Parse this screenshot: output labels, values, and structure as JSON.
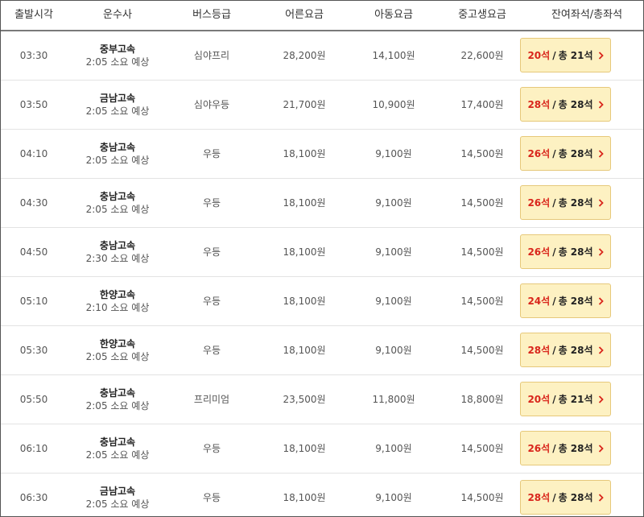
{
  "columns": {
    "departure_time": "출발시각",
    "company": "운수사",
    "bus_grade": "버스등급",
    "adult_fare": "어른요금",
    "child_fare": "아동요금",
    "teen_fare": "중고생요금",
    "seats": "잔여좌석/총좌석"
  },
  "accent_colors": {
    "remaining_seats": "#d9261c",
    "button_bg": "#fdf1c2",
    "button_border": "#e6c87a"
  },
  "rows": [
    {
      "time": "03:30",
      "company": "중부고속",
      "duration": "2:05 소요 예상",
      "grade": "심야프리",
      "adult": "28,200원",
      "child": "14,100원",
      "teen": "22,600원",
      "remaining": "20석",
      "sep": "/",
      "total": "총 21석"
    },
    {
      "time": "03:50",
      "company": "금남고속",
      "duration": "2:05 소요 예상",
      "grade": "심야우등",
      "adult": "21,700원",
      "child": "10,900원",
      "teen": "17,400원",
      "remaining": "28석",
      "sep": "/",
      "total": "총 28석"
    },
    {
      "time": "04:10",
      "company": "충남고속",
      "duration": "2:05 소요 예상",
      "grade": "우등",
      "adult": "18,100원",
      "child": "9,100원",
      "teen": "14,500원",
      "remaining": "26석",
      "sep": "/",
      "total": "총 28석"
    },
    {
      "time": "04:30",
      "company": "충남고속",
      "duration": "2:05 소요 예상",
      "grade": "우등",
      "adult": "18,100원",
      "child": "9,100원",
      "teen": "14,500원",
      "remaining": "26석",
      "sep": "/",
      "total": "총 28석"
    },
    {
      "time": "04:50",
      "company": "충남고속",
      "duration": "2:30 소요 예상",
      "grade": "우등",
      "adult": "18,100원",
      "child": "9,100원",
      "teen": "14,500원",
      "remaining": "26석",
      "sep": "/",
      "total": "총 28석"
    },
    {
      "time": "05:10",
      "company": "한양고속",
      "duration": "2:10 소요 예상",
      "grade": "우등",
      "adult": "18,100원",
      "child": "9,100원",
      "teen": "14,500원",
      "remaining": "24석",
      "sep": "/",
      "total": "총 28석"
    },
    {
      "time": "05:30",
      "company": "한양고속",
      "duration": "2:05 소요 예상",
      "grade": "우등",
      "adult": "18,100원",
      "child": "9,100원",
      "teen": "14,500원",
      "remaining": "28석",
      "sep": "/",
      "total": "총 28석"
    },
    {
      "time": "05:50",
      "company": "충남고속",
      "duration": "2:05 소요 예상",
      "grade": "프리미엄",
      "adult": "23,500원",
      "child": "11,800원",
      "teen": "18,800원",
      "remaining": "20석",
      "sep": "/",
      "total": "총 21석"
    },
    {
      "time": "06:10",
      "company": "충남고속",
      "duration": "2:05 소요 예상",
      "grade": "우등",
      "adult": "18,100원",
      "child": "9,100원",
      "teen": "14,500원",
      "remaining": "26석",
      "sep": "/",
      "total": "총 28석"
    },
    {
      "time": "06:30",
      "company": "금남고속",
      "duration": "2:05 소요 예상",
      "grade": "우등",
      "adult": "18,100원",
      "child": "9,100원",
      "teen": "14,500원",
      "remaining": "28석",
      "sep": "/",
      "total": "총 28석"
    }
  ]
}
